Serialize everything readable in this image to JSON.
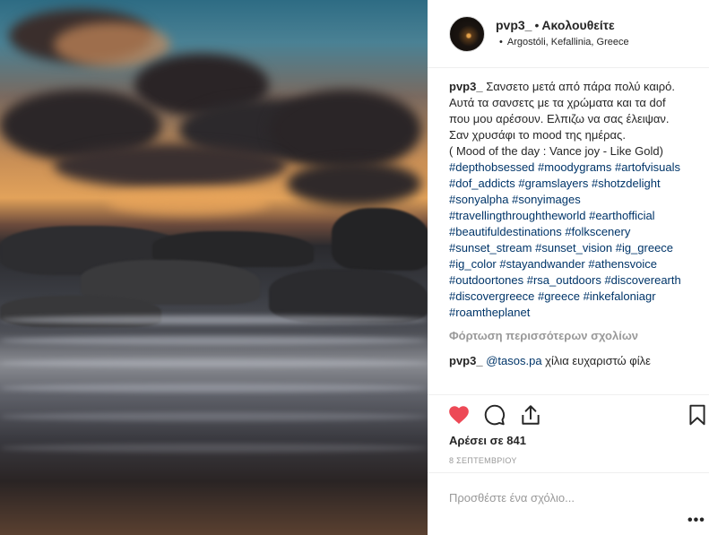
{
  "post": {
    "username": "pvp3_",
    "follow_separator": "•",
    "follow_label": "Ακολουθείτε",
    "location_bullet": "•",
    "location": "Argostóli, Kefallinia, Greece"
  },
  "caption": {
    "username": "pvp3_",
    "text": " Σανσετο μετά από πάρα πολύ καιρό.\nΑυτά τα σανσετς με τα χρώματα και τα dof που μου αρέσουν. Ελπιζω να σας έλειψαν. Σαν χρυσάφι το mood της ημέρας.\n( Mood of the day : Vance joy - Like Gold)\n",
    "hashtags": "#depthobsessed #moodygrams #artofvisuals #dof_addicts #gramslayers #shotzdelight #sonyalpha #sonyimages #travellingthroughtheworld #earthofficial #beautifuldestinations #folkscenery #sunset_stream #sunset_vision #ig_greece #ig_color #stayandwander #athensvoice #outdoortones #rsa_outdoors #discoverearth #discovergreece #greece #inkefaloniagr #roamtheplanet"
  },
  "load_more_label": "Φόρτωση περισσότερων σχολίων",
  "comment2": {
    "username": "pvp3_",
    "mention": "@tasos.pa",
    "text": " χίλια ευχαριστώ φίλε"
  },
  "icons": {
    "like": "heart-icon",
    "comment": "comment-icon",
    "share": "share-icon",
    "save": "bookmark-icon",
    "more": "more-options-icon"
  },
  "colors": {
    "like_red": "#ed4956",
    "link_blue": "#003569",
    "muted_gray": "#999999"
  },
  "likes_label": "Αρέσει σε 841",
  "date_label": "8 ΣΕΠΤΕΜΒΡΙΟΥ",
  "comment_input": {
    "placeholder": "Προσθέστε ένα σχόλιο..."
  },
  "more_label": "•••"
}
